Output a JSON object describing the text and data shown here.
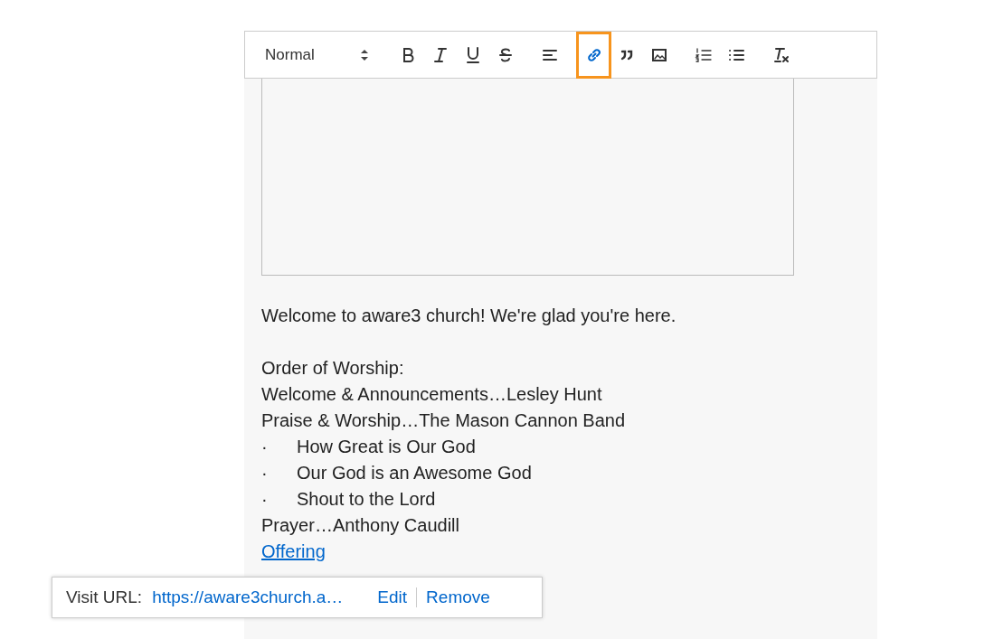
{
  "toolbar": {
    "format": "Normal",
    "buttons": [
      {
        "kind": "bold",
        "selected": false
      },
      {
        "kind": "italic",
        "selected": false
      },
      {
        "kind": "underline",
        "selected": false
      },
      {
        "kind": "strike",
        "selected": false
      },
      {
        "kind": "align",
        "selected": false
      },
      {
        "kind": "link",
        "selected": true
      },
      {
        "kind": "quote",
        "selected": false
      },
      {
        "kind": "image",
        "selected": false
      },
      {
        "kind": "ordered",
        "selected": false
      },
      {
        "kind": "bullet",
        "selected": false
      },
      {
        "kind": "clean",
        "selected": false
      }
    ]
  },
  "editor": {
    "lines": [
      {
        "kind": "text",
        "text": "Welcome to aware3 church! We're glad you're here."
      },
      {
        "kind": "blank"
      },
      {
        "kind": "text",
        "text": "Order of Worship:"
      },
      {
        "kind": "text",
        "text": "Welcome & Announcements…Lesley Hunt"
      },
      {
        "kind": "text",
        "text": "Praise & Worship…The Mason Cannon Band"
      },
      {
        "kind": "bullet",
        "marker": "·",
        "text": "How Great is Our God"
      },
      {
        "kind": "bullet",
        "marker": "·",
        "text": "Our God is an Awesome God"
      },
      {
        "kind": "bullet",
        "marker": "·",
        "text": "Shout to the Lord"
      },
      {
        "kind": "text",
        "text": "Prayer…Anthony Caudill"
      },
      {
        "kind": "link",
        "text": "Offering"
      }
    ]
  },
  "link_tooltip": {
    "label": "Visit URL:",
    "url": "https://aware3church.a…",
    "actions": [
      "Edit",
      "Remove"
    ]
  }
}
